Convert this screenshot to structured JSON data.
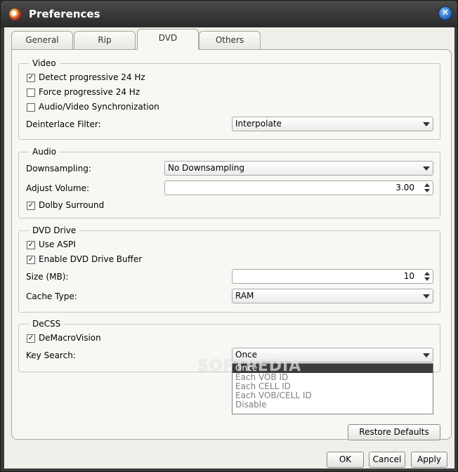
{
  "window": {
    "title": "Preferences"
  },
  "tabs": [
    "General",
    "Rip",
    "DVD",
    "Others"
  ],
  "video": {
    "title": "Video",
    "detect_progressive": {
      "label": "Detect progressive 24 Hz",
      "checked": true
    },
    "force_progressive": {
      "label": "Force progressive 24 Hz",
      "checked": false
    },
    "av_sync": {
      "label": "Audio/Video Synchronization",
      "checked": false
    },
    "deinterlace_label": "Deinterlace Filter:",
    "deinterlace_value": "Interpolate"
  },
  "audio": {
    "title": "Audio",
    "downsampling_label": "Downsampling:",
    "downsampling_value": "No Downsampling",
    "volume_label": "Adjust Volume:",
    "volume_value": "3.00",
    "dolby": {
      "label": "Dolby Surround",
      "checked": true
    }
  },
  "dvd_drive": {
    "title": "DVD Drive",
    "use_aspi": {
      "label": "Use ASPI",
      "checked": true
    },
    "enable_buffer": {
      "label": "Enable DVD Drive Buffer",
      "checked": true
    },
    "size_label": "Size (MB):",
    "size_value": "10",
    "cache_label": "Cache Type:",
    "cache_value": "RAM"
  },
  "decss": {
    "title": "DeCSS",
    "demacrovision": {
      "label": "DeMacroVision",
      "checked": true
    },
    "key_search_label": "Key Search:",
    "key_search_value": "Once",
    "options": [
      "Once",
      "Each VOB ID",
      "Each CELL ID",
      "Each VOB/CELL ID",
      "Disable"
    ]
  },
  "buttons": {
    "restore": "Restore Defaults",
    "ok": "OK",
    "cancel": "Cancel",
    "apply": "Apply"
  },
  "watermark": "SOFTPEDIA",
  "check_glyph": "✓"
}
